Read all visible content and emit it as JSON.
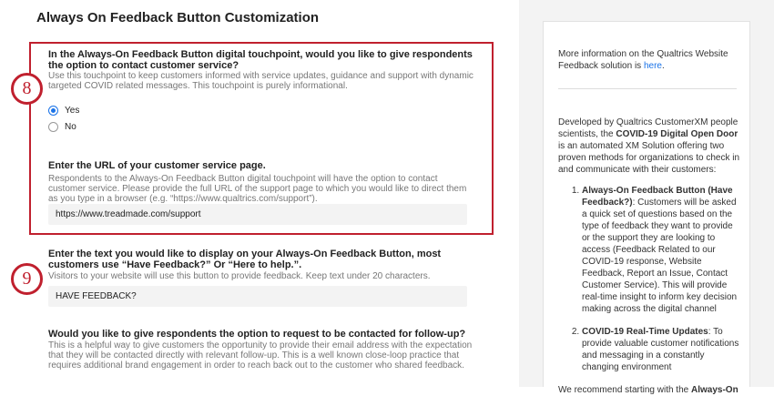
{
  "page_title": "Always On Feedback Button Customization",
  "step_badges": [
    "8",
    "9"
  ],
  "q1": {
    "question": "In the Always-On Feedback Button digital touchpoint, would you like to give respondents the option to contact customer service?",
    "description": "Use this touchpoint to keep customers informed with service updates, guidance and support with dynamic targeted COVID related messages. This touchpoint is purely informational.",
    "options": [
      {
        "label": "Yes",
        "selected": true
      },
      {
        "label": "No",
        "selected": false
      }
    ]
  },
  "q_url": {
    "question": "Enter the URL of your customer service page.",
    "description": "Respondents to the Always-On Feedback Button digital touchpoint will have the option to contact customer service. Please provide the full URL of the support page to which you would like to direct them as you type in a browser (e.g. “https://www.qualtrics.com/support”).",
    "value": "https://www.treadmade.com/support"
  },
  "q_text": {
    "question": "Enter the text you would like to display on your Always-On Feedback Button, most customers use “Have Feedback?” Or “Here to help.”.",
    "description": "Visitors to your website will use this button to provide feedback. Keep text under 20 characters.",
    "value": "HAVE FEEDBACK?"
  },
  "q_followup": {
    "question": "Would you like to give respondents the option to request to be contacted for follow-up?",
    "description": "This is a helpful way to give customers the opportunity to provide their email address with the expectation that they will be contacted directly with relevant follow-up. This is a well known close-loop practice that requires additional brand engagement in order to reach back out to the customer who shared feedback."
  },
  "sidebar": {
    "info_text": "More information on the Qualtrics Website Feedback solution is ",
    "info_link": "here",
    "info_end": ".",
    "intro_1": "Developed by Qualtrics CustomerXM people scientists, the ",
    "intro_bold": "COVID-19 Digital Open Door",
    "intro_2": " is an automated XM Solution offering two proven methods for organizations to check in and communicate with their customers:",
    "items": [
      {
        "bold": "Always-On Feedback Button (Have Feedback?)",
        "text": ": Customers will be asked a quick set of questions based on the type of feedback they want to provide or the support they are looking to access (Feedback Related to our COVID-19 response, Website Feedback, Report an Issue, Contact Customer Service). This will provide real-time insight to inform key decision making across the digital channel"
      },
      {
        "bold": "COVID-19 Real-Time Updates",
        "text": ": To provide valuable customer notifications and messaging in a constantly changing environment"
      }
    ],
    "recommend": "We recommend starting with the ",
    "recommend_bold": "Always-On"
  }
}
